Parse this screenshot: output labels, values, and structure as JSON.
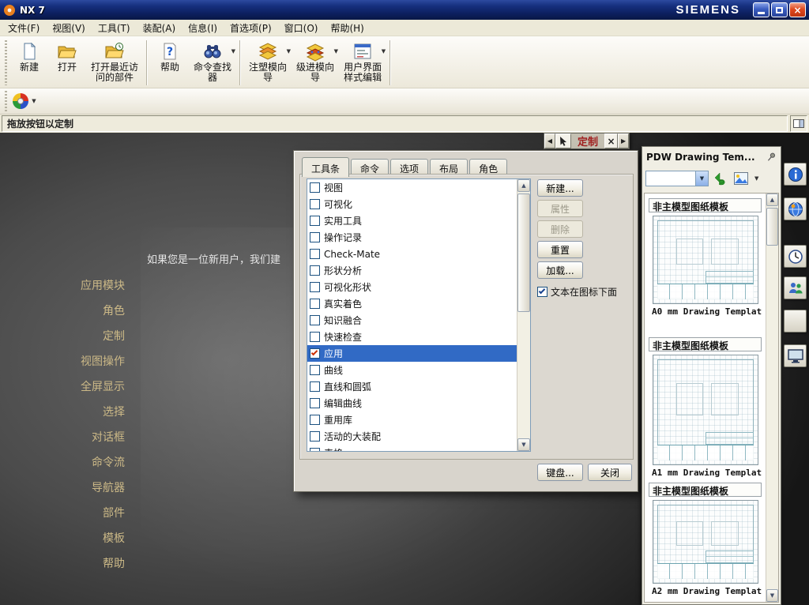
{
  "titlebar": {
    "title": "NX 7",
    "brand": "SIEMENS"
  },
  "menubar": {
    "items": [
      {
        "label": "文件(F)"
      },
      {
        "label": "视图(V)"
      },
      {
        "label": "工具(T)"
      },
      {
        "label": "装配(A)"
      },
      {
        "label": "信息(I)"
      },
      {
        "label": "首选项(P)"
      },
      {
        "label": "窗口(O)"
      },
      {
        "label": "帮助(H)"
      }
    ]
  },
  "toolbar": {
    "buttons": [
      {
        "label": "新建"
      },
      {
        "label": "打开"
      },
      {
        "label": "打开最近访\n问的部件"
      },
      {
        "label": "帮助"
      },
      {
        "label": "命令查找\n器"
      },
      {
        "label": "注塑模向\n导"
      },
      {
        "label": "级进模向\n导"
      },
      {
        "label": "用户界面\n样式编辑"
      }
    ]
  },
  "prompt_bar": {
    "text": "拖放按钮以定制"
  },
  "main": {
    "welcome_text": "如果您是一位新用户，我们建",
    "sidebar_items": [
      {
        "label": "应用模块"
      },
      {
        "label": "角色"
      },
      {
        "label": "定制"
      },
      {
        "label": "视图操作"
      },
      {
        "label": "全屏显示"
      },
      {
        "label": "选择"
      },
      {
        "label": "对话框"
      },
      {
        "label": "命令流"
      },
      {
        "label": "导航器"
      },
      {
        "label": "部件"
      },
      {
        "label": "模板"
      },
      {
        "label": "帮助"
      }
    ]
  },
  "mini_toolbar": {
    "label": "定制",
    "left_arrow": "◀",
    "right_arrow": "▶",
    "close": "×"
  },
  "dialog": {
    "tabs": [
      {
        "label": "工具条",
        "active": true
      },
      {
        "label": "命令",
        "active": false
      },
      {
        "label": "选项",
        "active": false
      },
      {
        "label": "布局",
        "active": false
      },
      {
        "label": "角色",
        "active": false
      }
    ],
    "toolbars": [
      {
        "label": "视图",
        "checked": false,
        "selected": false
      },
      {
        "label": "可视化",
        "checked": false,
        "selected": false
      },
      {
        "label": "实用工具",
        "checked": false,
        "selected": false
      },
      {
        "label": "操作记录",
        "checked": false,
        "selected": false
      },
      {
        "label": "Check-Mate",
        "checked": false,
        "selected": false
      },
      {
        "label": "形状分析",
        "checked": false,
        "selected": false
      },
      {
        "label": "可视化形状",
        "checked": false,
        "selected": false
      },
      {
        "label": "真实着色",
        "checked": false,
        "selected": false
      },
      {
        "label": "知识融合",
        "checked": false,
        "selected": false
      },
      {
        "label": "快速检查",
        "checked": false,
        "selected": false
      },
      {
        "label": "应用",
        "checked": true,
        "selected": true
      },
      {
        "label": "曲线",
        "checked": false,
        "selected": false
      },
      {
        "label": "直线和圆弧",
        "checked": false,
        "selected": false
      },
      {
        "label": "编辑曲线",
        "checked": false,
        "selected": false
      },
      {
        "label": "重用库",
        "checked": false,
        "selected": false
      },
      {
        "label": "活动的大装配",
        "checked": false,
        "selected": false
      },
      {
        "label": "表格",
        "checked": false,
        "selected": false
      }
    ],
    "side_buttons": [
      {
        "label": "新建...",
        "disabled": false
      },
      {
        "label": "属性",
        "disabled": true
      },
      {
        "label": "删除",
        "disabled": true
      },
      {
        "label": "重置",
        "disabled": false
      },
      {
        "label": "加载...",
        "disabled": false
      }
    ],
    "text_under_icon": {
      "label": "文本在图标下面",
      "checked": true
    },
    "footer": {
      "keyboard": "键盘...",
      "close": "关闭"
    }
  },
  "palette": {
    "title": "PDW Drawing Tem...",
    "combo_value": "",
    "groups": [
      {
        "header": "非主模型图纸模板",
        "caption": "A0 mm Drawing Templat"
      },
      {
        "header": "非主模型图纸模板",
        "caption": "A1 mm Drawing Templat"
      },
      {
        "header": "非主模型图纸模板",
        "caption": "A2 mm Drawing Templat"
      }
    ]
  },
  "colors": {
    "selection": "#316ac5",
    "sidebar_text": "#ccb987",
    "customize_label": "#a02020",
    "titlebar_blue": "#0c1f5e",
    "close_red": "#e0491f"
  }
}
